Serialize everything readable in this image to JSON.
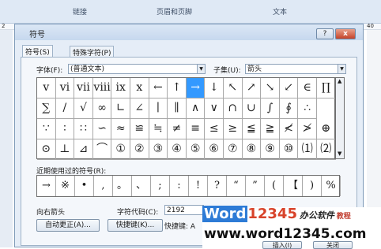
{
  "ribbon": {
    "groups": [
      "链接",
      "页眉和页脚",
      "文本"
    ]
  },
  "ruler": {
    "left_mark": "2",
    "right_mark": "40"
  },
  "dialog": {
    "title": "符号",
    "help_icon": "?",
    "close_icon": "x",
    "tabs": [
      "符号(S)",
      "特殊字符(P)"
    ],
    "font_label": "字体(F):",
    "font_value": "(普通文本)",
    "subset_label": "子集(U):",
    "subset_value": "箭头",
    "symbols": [
      [
        "v",
        "vi",
        "vii",
        "viii",
        "ix",
        "x",
        "←",
        "↑",
        "→",
        "↓",
        "↖",
        "↗",
        "↘",
        "↙",
        "∈",
        "∏"
      ],
      [
        "∑",
        "/",
        "√",
        "∞",
        "∟",
        "∠",
        "∣",
        "∥",
        "∧",
        "∨",
        "∩",
        "∪",
        "∫",
        "∮",
        "∴"
      ],
      [
        "∵",
        "∶",
        "∷",
        "∽",
        "≈",
        "≌",
        "≒",
        "≠",
        "≡",
        "≤",
        "≥",
        "≦",
        "≧",
        "≮",
        "≯",
        "⊕"
      ],
      [
        "⊙",
        "⊥",
        "⊿",
        "⌒",
        "①",
        "②",
        "③",
        "④",
        "⑤",
        "⑥",
        "⑦",
        "⑧",
        "⑨",
        "⑩",
        "⑴",
        "⑵"
      ]
    ],
    "recent_label": "近期使用过的符号(R):",
    "recent_symbols": [
      "→",
      "※",
      "•",
      ",",
      "。",
      "、",
      ";",
      ":",
      "!",
      "?",
      "“",
      "”",
      "(",
      "【",
      ")",
      "%"
    ],
    "char_name": "向右箭头",
    "charcode_label": "字符代码(C):",
    "charcode_value": "2192",
    "from_label": "来自",
    "autocorrect_button": "自动更正(A)...",
    "shortcut_key_button": "快捷键(K)...",
    "shortcut_label": "快捷键:",
    "shortcut_value": "A",
    "insert_button": "插入(I)",
    "close_button": "关闭"
  },
  "watermark": {
    "brand_word": "Word",
    "brand_digits": "12345",
    "brand_tail": "办公软件",
    "brand_suffix": "教程",
    "url": "www.word12345.com"
  }
}
